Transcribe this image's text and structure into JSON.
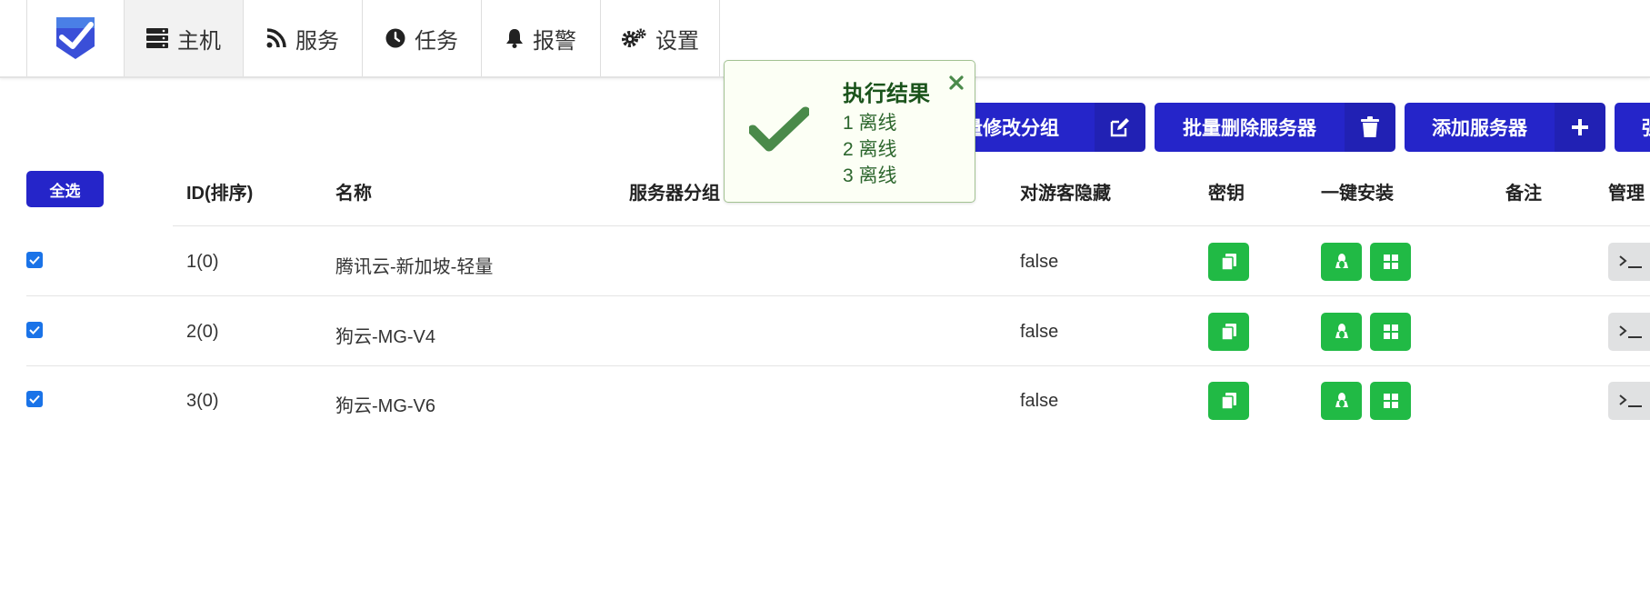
{
  "nav": {
    "items": [
      {
        "label": "主机",
        "icon": "server-icon",
        "active": true
      },
      {
        "label": "服务",
        "icon": "rss-icon",
        "active": false
      },
      {
        "label": "任务",
        "icon": "clock-icon",
        "active": false
      },
      {
        "label": "报警",
        "icon": "bell-icon",
        "active": false
      },
      {
        "label": "设置",
        "icon": "cogs-icon",
        "active": false
      }
    ]
  },
  "actions": {
    "batch_group": "批量修改分组",
    "batch_delete": "批量删除服务器",
    "add_server": "添加服务器",
    "partial_label": "强"
  },
  "table": {
    "select_all": "全选",
    "headers": {
      "id": "ID(排序)",
      "name": "名称",
      "group": "服务器分组",
      "hide": "对游客隐藏",
      "secret": "密钥",
      "install": "一键安装",
      "note": "备注",
      "manage": "管理"
    },
    "rows": [
      {
        "id": "1(0)",
        "name": "腾讯云-新加坡-轻量",
        "group": "",
        "hide": "false",
        "note": "",
        "checked": true
      },
      {
        "id": "2(0)",
        "name": "狗云-MG-V4",
        "group": "",
        "hide": "false",
        "note": "",
        "checked": true
      },
      {
        "id": "3(0)",
        "name": "狗云-MG-V6",
        "group": "",
        "hide": "false",
        "note": "",
        "checked": true
      }
    ]
  },
  "toast": {
    "title": "执行结果",
    "lines": [
      "1 离线",
      "2 离线",
      "3 离线"
    ],
    "type": "success"
  },
  "colors": {
    "primary": "#2525c9",
    "success": "#21ba45",
    "toast_bg": "#fcfff5",
    "toast_text": "#2c662d",
    "check": "#4a8a4a"
  }
}
